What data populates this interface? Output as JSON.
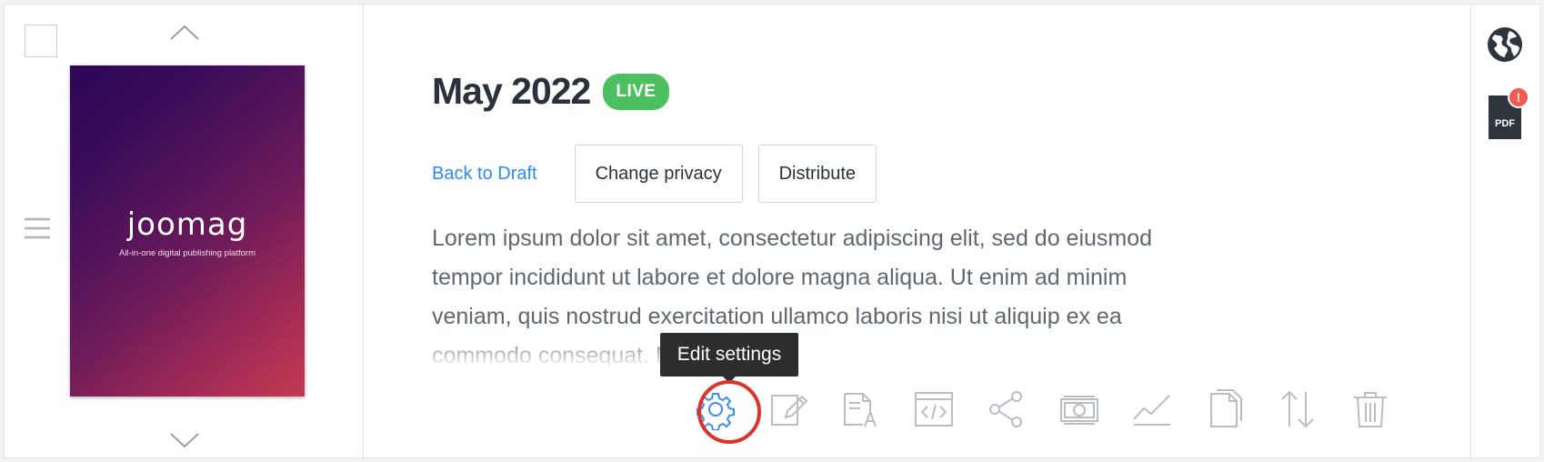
{
  "issue": {
    "title": "May 2022",
    "status_badge": "LIVE",
    "description": "Lorem ipsum dolor sit amet, consectetur adipiscing elit, sed do eiusmod tempor incididunt ut labore et dolore magna aliqua. Ut enim ad minim veniam, quis nostrud exercitation ullamco laboris nisi ut aliquip ex ea commodo consequat. Duis aute"
  },
  "cover": {
    "logo_text": "joomag",
    "tagline": "All-in-one digital publishing platform",
    "gradient_colors": [
      "#2d0756",
      "#6a1a5a",
      "#c43a52"
    ]
  },
  "actions": {
    "back_to_draft": "Back to Draft",
    "change_privacy": "Change privacy",
    "distribute": "Distribute"
  },
  "tooltip": {
    "text": "Edit settings"
  },
  "toolbar": [
    {
      "icon": "gear-icon",
      "label": "Edit settings",
      "highlighted": true
    },
    {
      "icon": "pencil-icon"
    },
    {
      "icon": "text-edit-icon"
    },
    {
      "icon": "embed-code-icon"
    },
    {
      "icon": "share-icon"
    },
    {
      "icon": "money-icon"
    },
    {
      "icon": "analytics-icon"
    },
    {
      "icon": "copy-icon"
    },
    {
      "icon": "sort-icon"
    },
    {
      "icon": "trash-icon"
    }
  ],
  "sidebar_right": {
    "globe_icon": "globe-icon",
    "pdf_icon": "pdf-icon",
    "pdf_badge": "!",
    "pdf_label": "PDF"
  },
  "colors": {
    "accent_link": "#2c8bee",
    "live_green": "#4cc05e",
    "highlight_red": "#d9352a",
    "active_icon": "#3a8fe8",
    "muted_icon": "#b9bec4"
  }
}
